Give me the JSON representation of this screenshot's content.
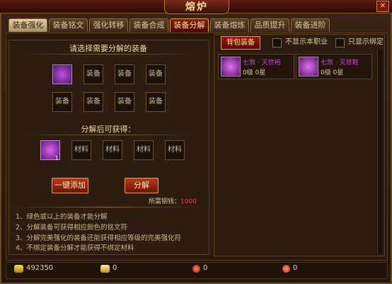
{
  "window": {
    "title": "熔炉",
    "close": "✕"
  },
  "tabs": [
    "装备强化",
    "装备铭文",
    "强化转移",
    "装备合成",
    "装备分解",
    "装备熔炼",
    "品质提升",
    "装备进阶"
  ],
  "left": {
    "select_title": "请选择需要分解的装备",
    "equip_slots": [
      "",
      "装备",
      "装备",
      "装备",
      "装备",
      "装备",
      "装备",
      "装备"
    ],
    "result_title": "分解后可获得：",
    "material_slots": [
      "",
      "材料",
      "材料",
      "材料",
      "材料"
    ],
    "material_qty": "1",
    "btn_add": "一键添加",
    "btn_decompose": "分解",
    "cost_label": "所需铜钱：",
    "cost_value": "1000",
    "notes": [
      "1、绿色或以上的装备才能分解",
      "2、分解装备可获得相应颜色的铭文符",
      "3、分解完美强化的装备还能获得相应等级的完美强化符",
      "4、不绑定装备分解才能获得不绑定材料"
    ]
  },
  "right": {
    "tab_bag": "背包装备",
    "chk_not_job": "不显示本职业",
    "chk_bound": "只显示绑定",
    "items": [
      {
        "name": "七煞 · 灭世袍",
        "level": "0级 0星"
      },
      {
        "name": "七煞 · 灭世鞋",
        "level": "0级 0星"
      }
    ]
  },
  "currency": {
    "gold": "492350",
    "ingot": "0",
    "gift": "0",
    "bind": "0"
  },
  "colors": {
    "accent_red": "#ff3a2a",
    "item_purple": "#d040e0",
    "gold_text": "#f3d58a"
  }
}
